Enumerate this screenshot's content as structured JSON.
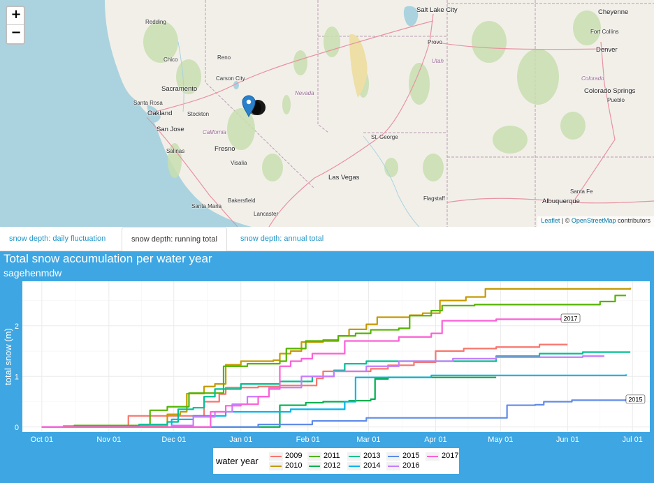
{
  "map": {
    "zoom_in_label": "+",
    "zoom_out_label": "−",
    "attribution": {
      "leaflet": "Leaflet",
      "separator": " | © ",
      "osm": "OpenStreetMap",
      "suffix": " contributors"
    },
    "marker_icon": "map-pin-icon",
    "cities": [
      {
        "name": "Salt Lake City",
        "cls": "big"
      },
      {
        "name": "Cheyenne",
        "cls": "big"
      },
      {
        "name": "Redding",
        "cls": ""
      },
      {
        "name": "Provo",
        "cls": ""
      },
      {
        "name": "Fort Collins",
        "cls": ""
      },
      {
        "name": "Chico",
        "cls": ""
      },
      {
        "name": "Reno",
        "cls": ""
      },
      {
        "name": "Denver",
        "cls": "big"
      },
      {
        "name": "Utah",
        "cls": "state"
      },
      {
        "name": "Carson City",
        "cls": ""
      },
      {
        "name": "Sacramento",
        "cls": "big"
      },
      {
        "name": "Nevada",
        "cls": "state"
      },
      {
        "name": "Colorado",
        "cls": "state"
      },
      {
        "name": "Colorado Springs",
        "cls": "big"
      },
      {
        "name": "Santa Rosa",
        "cls": ""
      },
      {
        "name": "Pueblo",
        "cls": ""
      },
      {
        "name": "Oakland",
        "cls": "big"
      },
      {
        "name": "Stockton",
        "cls": ""
      },
      {
        "name": "San Jose",
        "cls": "big"
      },
      {
        "name": "California",
        "cls": "state"
      },
      {
        "name": "St. George",
        "cls": ""
      },
      {
        "name": "Salinas",
        "cls": ""
      },
      {
        "name": "Fresno",
        "cls": "big"
      },
      {
        "name": "Visalia",
        "cls": ""
      },
      {
        "name": "Las Vegas",
        "cls": "big"
      },
      {
        "name": "Santa Fe",
        "cls": ""
      },
      {
        "name": "Flagstaff",
        "cls": ""
      },
      {
        "name": "Bakersfield",
        "cls": ""
      },
      {
        "name": "Albuquerque",
        "cls": "big"
      },
      {
        "name": "Santa Maria",
        "cls": ""
      },
      {
        "name": "Lancaster",
        "cls": ""
      }
    ]
  },
  "tabs": [
    {
      "label": "snow depth: daily fluctuation",
      "active": false
    },
    {
      "label": "snow depth: running total",
      "active": true
    },
    {
      "label": "snow depth: annual total",
      "active": false
    }
  ],
  "chart": {
    "title": "Total snow accumulation per water year",
    "subtitle": "sagehenmdw"
  },
  "chart_data": {
    "type": "line",
    "title": "Total snow accumulation per water year",
    "subtitle": "sagehenmdw",
    "xlabel": "",
    "ylabel": "total snow (m)",
    "x_ticks": [
      "Oct 01",
      "Nov 01",
      "Dec 01",
      "Jan 01",
      "Feb 01",
      "Mar 01",
      "Apr 01",
      "May 01",
      "Jun 01",
      "Jul 01"
    ],
    "y_ticks": [
      0,
      1,
      2
    ],
    "xlim_days": [
      -9,
      281
    ],
    "ylim": [
      -0.1,
      2.88
    ],
    "grid": true,
    "legend_title": "water year",
    "legend_position": "bottom",
    "annotations": [
      {
        "text": "2017",
        "series": "2017"
      },
      {
        "text": "2015",
        "series": "2015"
      }
    ],
    "series": [
      {
        "name": "2009",
        "color": "#f8766d",
        "points": [
          [
            0,
            0
          ],
          [
            38,
            0
          ],
          [
            40,
            0.22
          ],
          [
            62,
            0.22
          ],
          [
            72,
            0.22
          ],
          [
            75,
            0.5
          ],
          [
            82,
            0.65
          ],
          [
            85,
            0.78
          ],
          [
            100,
            0.8
          ],
          [
            110,
            0.82
          ],
          [
            125,
            0.82
          ],
          [
            127,
            0.96
          ],
          [
            130,
            1.1
          ],
          [
            152,
            1.15
          ],
          [
            160,
            1.22
          ],
          [
            172,
            1.28
          ],
          [
            182,
            1.5
          ],
          [
            195,
            1.55
          ],
          [
            210,
            1.58
          ],
          [
            230,
            1.63
          ],
          [
            243,
            1.63
          ]
        ]
      },
      {
        "name": "2010",
        "color": "#c49a00",
        "points": [
          [
            0,
            0
          ],
          [
            10,
            0.02
          ],
          [
            55,
            0.02
          ],
          [
            58,
            0.25
          ],
          [
            64,
            0.3
          ],
          [
            67,
            0.66
          ],
          [
            72,
            0.66
          ],
          [
            75,
            0.8
          ],
          [
            80,
            0.85
          ],
          [
            85,
            1.23
          ],
          [
            92,
            1.3
          ],
          [
            107,
            1.32
          ],
          [
            110,
            1.45
          ],
          [
            115,
            1.5
          ],
          [
            120,
            1.68
          ],
          [
            130,
            1.72
          ],
          [
            137,
            1.8
          ],
          [
            142,
            1.93
          ],
          [
            150,
            2.03
          ],
          [
            155,
            2.17
          ],
          [
            170,
            2.21
          ],
          [
            176,
            2.25
          ],
          [
            184,
            2.5
          ],
          [
            196,
            2.57
          ],
          [
            205,
            2.73
          ],
          [
            225,
            2.73
          ],
          [
            240,
            2.73
          ],
          [
            272,
            2.75
          ]
        ]
      },
      {
        "name": "2011",
        "color": "#53b400",
        "points": [
          [
            0,
            0
          ],
          [
            15,
            0.03
          ],
          [
            45,
            0.05
          ],
          [
            50,
            0.33
          ],
          [
            58,
            0.4
          ],
          [
            68,
            0.67
          ],
          [
            78,
            0.67
          ],
          [
            84,
            1.2
          ],
          [
            95,
            1.25
          ],
          [
            110,
            1.3
          ],
          [
            113,
            1.55
          ],
          [
            122,
            1.7
          ],
          [
            137,
            1.8
          ],
          [
            145,
            1.85
          ],
          [
            152,
            1.92
          ],
          [
            165,
            1.95
          ],
          [
            170,
            2.2
          ],
          [
            180,
            2.3
          ],
          [
            185,
            2.4
          ],
          [
            200,
            2.42
          ],
          [
            240,
            2.42
          ],
          [
            258,
            2.48
          ],
          [
            265,
            2.6
          ],
          [
            270,
            2.6
          ]
        ]
      },
      {
        "name": "2012",
        "color": "#00b050",
        "points": [
          [
            0,
            0
          ],
          [
            105,
            0
          ],
          [
            110,
            0.43
          ],
          [
            122,
            0.48
          ],
          [
            130,
            0.5
          ],
          [
            142,
            0.52
          ],
          [
            152,
            0.55
          ],
          [
            154,
            0.95
          ],
          [
            160,
            0.98
          ],
          [
            200,
            0.98
          ],
          [
            210,
            0.98
          ]
        ]
      },
      {
        "name": "2013",
        "color": "#00c094",
        "points": [
          [
            0,
            0
          ],
          [
            45,
            0.05
          ],
          [
            58,
            0.1
          ],
          [
            63,
            0.35
          ],
          [
            70,
            0.38
          ],
          [
            75,
            0.6
          ],
          [
            80,
            0.75
          ],
          [
            92,
            0.85
          ],
          [
            110,
            0.9
          ],
          [
            125,
            1.0
          ],
          [
            135,
            1.12
          ],
          [
            140,
            1.25
          ],
          [
            150,
            1.3
          ],
          [
            190,
            1.3
          ],
          [
            210,
            1.4
          ],
          [
            230,
            1.45
          ],
          [
            250,
            1.48
          ],
          [
            272,
            1.48
          ]
        ]
      },
      {
        "name": "2014",
        "color": "#00b6eb",
        "points": [
          [
            0,
            0
          ],
          [
            50,
            0
          ],
          [
            60,
            0.15
          ],
          [
            70,
            0.22
          ],
          [
            85,
            0.3
          ],
          [
            115,
            0.35
          ],
          [
            140,
            0.5
          ],
          [
            145,
            0.98
          ],
          [
            165,
            0.98
          ],
          [
            180,
            1.02
          ],
          [
            270,
            1.04
          ]
        ]
      },
      {
        "name": "2015",
        "color": "#5f8be8",
        "points": [
          [
            0,
            0
          ],
          [
            100,
            0.05
          ],
          [
            125,
            0.12
          ],
          [
            150,
            0.18
          ],
          [
            210,
            0.18
          ],
          [
            215,
            0.43
          ],
          [
            228,
            0.44
          ],
          [
            232,
            0.5
          ],
          [
            245,
            0.53
          ],
          [
            270,
            0.55
          ]
        ]
      },
      {
        "name": "2016",
        "color": "#c77cff",
        "points": [
          [
            0,
            0
          ],
          [
            60,
            0.03
          ],
          [
            70,
            0.2
          ],
          [
            80,
            0.3
          ],
          [
            88,
            0.45
          ],
          [
            95,
            0.6
          ],
          [
            105,
            0.78
          ],
          [
            120,
            1.0
          ],
          [
            135,
            1.1
          ],
          [
            150,
            1.2
          ],
          [
            165,
            1.3
          ],
          [
            190,
            1.35
          ],
          [
            210,
            1.38
          ],
          [
            250,
            1.4
          ],
          [
            260,
            1.4
          ]
        ]
      },
      {
        "name": "2017",
        "color": "#fb61d7",
        "points": [
          [
            0,
            0
          ],
          [
            70,
            0
          ],
          [
            78,
            0.3
          ],
          [
            85,
            0.42
          ],
          [
            92,
            0.45
          ],
          [
            100,
            0.6
          ],
          [
            105,
            0.75
          ],
          [
            110,
            1.2
          ],
          [
            115,
            1.3
          ],
          [
            120,
            1.35
          ],
          [
            125,
            1.45
          ],
          [
            140,
            1.7
          ],
          [
            165,
            1.78
          ],
          [
            180,
            1.85
          ],
          [
            185,
            2.1
          ],
          [
            195,
            2.1
          ],
          [
            210,
            2.13
          ],
          [
            240,
            2.15
          ]
        ]
      }
    ]
  }
}
